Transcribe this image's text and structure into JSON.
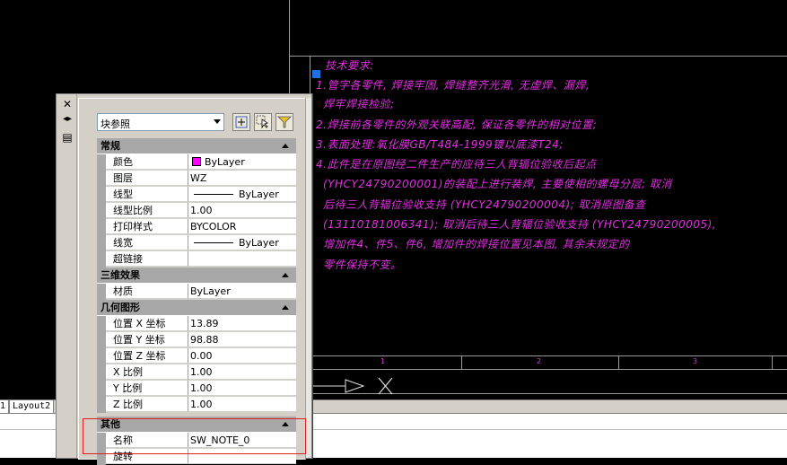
{
  "drawing": {
    "notes": [
      "技术要求:",
      "1.管字各零件, 焊接牢固, 焊缝整齐光滑, 无虚焊、漏焊,",
      "  焊牢焊接检验;",
      "2.焊接前各零件的外观关联高配, 保证各零件的相对位置;",
      "3.表面处理:氧化膜GB/T484-1999镀以底漆T24;",
      "4.此件是在原图经二件生产的应待三人背辐位验收后起点",
      "  (YHCY24790200001)的装配上进行装焊, 主要使相的螺母分层; 取消",
      "  后待三人背辐位验收支持 (YHCY24790200004); 取消原图备查",
      "  (13110181006341); 取消后待三人背辐位验收支持 (YHCY24790200005),",
      "  增加件4、件5、件6, 增加件的焊接位置见本图, 其余未规定的",
      "  零件保持不变。"
    ],
    "columns": [
      "1",
      "2",
      "3"
    ]
  },
  "layout_tabs": [
    "1",
    "Layout2"
  ],
  "palette": {
    "selected_object": "块参照",
    "sections": [
      {
        "title": "常规",
        "rows": [
          {
            "key": "颜色",
            "value": "ByLayer",
            "kind": "color",
            "swatch": "#ff00ff"
          },
          {
            "key": "图层",
            "value": "WZ"
          },
          {
            "key": "线型",
            "value": "ByLayer",
            "kind": "linetype"
          },
          {
            "key": "线型比例",
            "value": "1.00"
          },
          {
            "key": "打印样式",
            "value": "BYCOLOR"
          },
          {
            "key": "线宽",
            "value": "ByLayer",
            "kind": "linetype"
          },
          {
            "key": "超链接",
            "value": ""
          }
        ]
      },
      {
        "title": "三维效果",
        "rows": [
          {
            "key": "材质",
            "value": "ByLayer"
          }
        ]
      },
      {
        "title": "几何图形",
        "rows": [
          {
            "key": "位置 X 坐标",
            "value": "13.89"
          },
          {
            "key": "位置 Y 坐标",
            "value": "98.88"
          },
          {
            "key": "位置 Z 坐标",
            "value": "0.00"
          },
          {
            "key": "X 比例",
            "value": "1.00"
          },
          {
            "key": "Y 比例",
            "value": "1.00"
          },
          {
            "key": "Z 比例",
            "value": "1.00"
          }
        ]
      },
      {
        "title": "其他",
        "rows": [
          {
            "key": "名称",
            "value": "SW_NOTE_0"
          },
          {
            "key": "旋转",
            "value": ""
          }
        ]
      }
    ]
  },
  "colors": {
    "accent_magenta": "#e030e0",
    "highlight_red": "#e02020",
    "grip_blue": "#1e6fe0"
  }
}
